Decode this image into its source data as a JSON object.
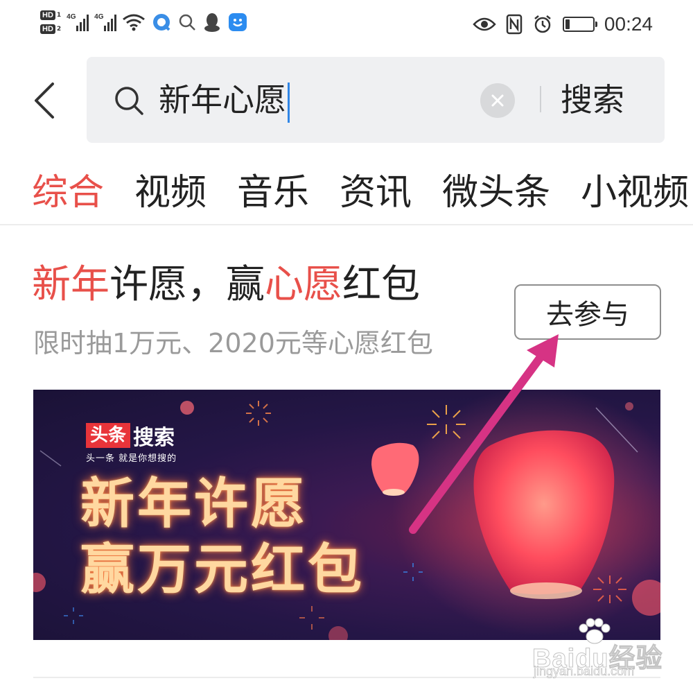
{
  "status_bar": {
    "sim1": "HD",
    "sim1_slot": "1",
    "sim2": "HD",
    "sim2_slot": "2",
    "net1": "4G",
    "net2": "4G",
    "time": "00:24",
    "battery_level": 0.15,
    "icons": [
      "wifi-icon",
      "browser-icon",
      "search-icon",
      "qq-icon",
      "assistant-icon",
      "eye-icon",
      "nfc-icon",
      "alarm-icon",
      "battery-icon"
    ]
  },
  "search": {
    "query": "新年心愿",
    "button_label": "搜索"
  },
  "tabs": [
    {
      "label": "综合",
      "active": true
    },
    {
      "label": "视频",
      "active": false
    },
    {
      "label": "音乐",
      "active": false
    },
    {
      "label": "资讯",
      "active": false
    },
    {
      "label": "微头条",
      "active": false
    },
    {
      "label": "小视频",
      "active": false
    }
  ],
  "card": {
    "title_parts": [
      "新年",
      "许愿，赢",
      "心愿",
      "红包"
    ],
    "subtitle": "限时抽1万元、2020元等心愿红包",
    "join_label": "去参与"
  },
  "banner": {
    "logo_red": "头条",
    "logo_white": "搜索",
    "slogan": "头一条 就是你想搜的",
    "line1": "新年许愿",
    "line2": "赢万元红包"
  },
  "watermark": {
    "main": "Baidu经验",
    "sub": "jingyan.baidu.com"
  },
  "colors": {
    "accent": "#e8504a",
    "arrow": "#d63384",
    "search_bg": "#eff0f2",
    "caret": "#2f86e6"
  }
}
